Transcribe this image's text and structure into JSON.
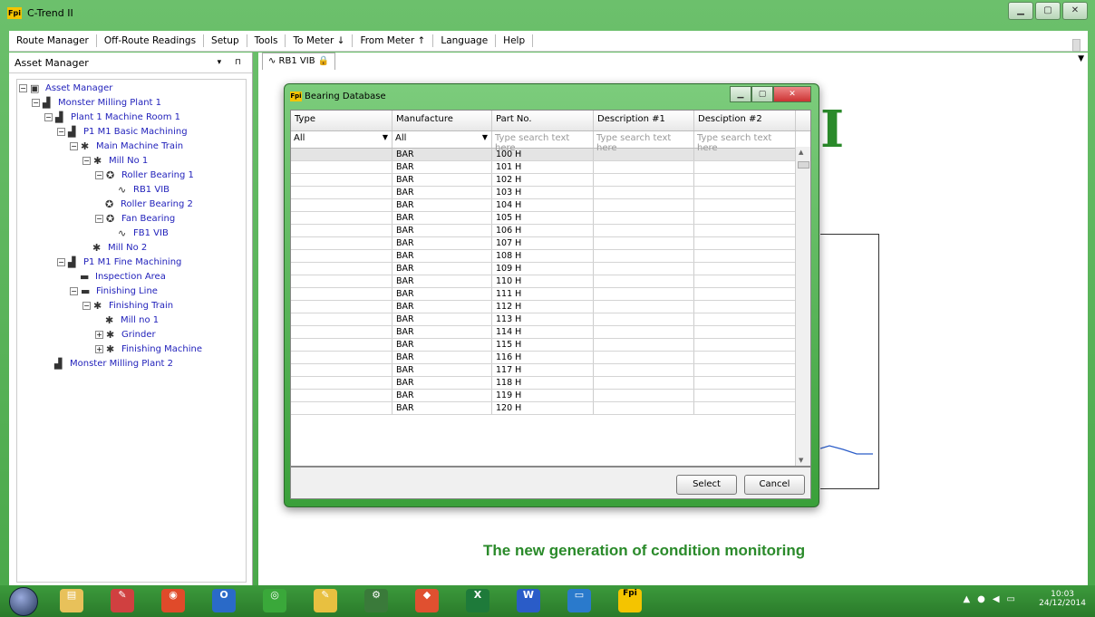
{
  "app": {
    "title": "C-Trend II",
    "logo_text": "Fpi"
  },
  "menu": [
    "Route Manager",
    "Off-Route Readings",
    "Setup",
    "Tools",
    "To Meter ↓",
    "From Meter ↑",
    "Language",
    "Help"
  ],
  "left_panel": {
    "title": "Asset Manager",
    "tools": "▾ ⊓"
  },
  "tree": [
    {
      "label": "Asset Manager",
      "icon": "folder-icon",
      "glyph": "▣",
      "depth": 0,
      "exp": "−"
    },
    {
      "label": "Monster Milling Plant 1",
      "icon": "plant-icon",
      "glyph": "▟",
      "depth": 1,
      "exp": "−"
    },
    {
      "label": "Plant 1 Machine Room 1",
      "icon": "factory-icon",
      "glyph": "▟",
      "depth": 2,
      "exp": "−"
    },
    {
      "label": "P1 M1 Basic Machining",
      "icon": "factory-icon",
      "glyph": "▟",
      "depth": 3,
      "exp": "−"
    },
    {
      "label": "Main Machine Train",
      "icon": "machine-train-icon",
      "glyph": "✱",
      "depth": 4,
      "exp": "−"
    },
    {
      "label": "Mill No 1",
      "icon": "mill-icon",
      "glyph": "✱",
      "depth": 5,
      "exp": "−"
    },
    {
      "label": "Roller Bearing 1",
      "icon": "bearing-icon",
      "glyph": "✪",
      "depth": 6,
      "exp": "−"
    },
    {
      "label": "RB1 VIB",
      "icon": "vibration-wave-icon",
      "glyph": "∿",
      "depth": 7,
      "exp": ""
    },
    {
      "label": "Roller Bearing 2",
      "icon": "bearing-icon",
      "glyph": "✪",
      "depth": 6,
      "exp": ""
    },
    {
      "label": "Fan Bearing",
      "icon": "bearing-icon",
      "glyph": "✪",
      "depth": 6,
      "exp": "−"
    },
    {
      "label": "FB1 VIB",
      "icon": "vibration-wave-icon",
      "glyph": "∿",
      "depth": 7,
      "exp": ""
    },
    {
      "label": "Mill No 2",
      "icon": "mill-icon",
      "glyph": "✱",
      "depth": 5,
      "exp": ""
    },
    {
      "label": "P1 M1 Fine Machining",
      "icon": "factory-icon",
      "glyph": "▟",
      "depth": 3,
      "exp": "−"
    },
    {
      "label": "Inspection Area",
      "icon": "area-icon",
      "glyph": "▬",
      "depth": 4,
      "exp": ""
    },
    {
      "label": "Finishing Line",
      "icon": "area-icon",
      "glyph": "▬",
      "depth": 4,
      "exp": "−"
    },
    {
      "label": "Finishing Train",
      "icon": "machine-train-icon",
      "glyph": "✱",
      "depth": 5,
      "exp": "−"
    },
    {
      "label": "Mill no 1",
      "icon": "mill-icon",
      "glyph": "✱",
      "depth": 6,
      "exp": ""
    },
    {
      "label": "Grinder",
      "icon": "mill-icon",
      "glyph": "✱",
      "depth": 6,
      "exp": "+"
    },
    {
      "label": "Finishing Machine",
      "icon": "mill-icon",
      "glyph": "✱",
      "depth": 6,
      "exp": "+"
    },
    {
      "label": "Monster Milling Plant 2",
      "icon": "plant-icon",
      "glyph": "▟",
      "depth": 2,
      "exp": ""
    }
  ],
  "tab": {
    "label": "∿ RB1 VIB 🔒"
  },
  "tagline": "The new generation of condition monitoring",
  "brand_letter": "I",
  "dialog": {
    "title": "Bearing Database",
    "columns": [
      "Type",
      "Manufacture",
      "Part No.",
      "Description #1",
      "Desciption #2"
    ],
    "filters": [
      "All",
      "All",
      "Type search text here",
      "Type search text here",
      "Type search text here"
    ],
    "rows": [
      [
        "",
        "BAR",
        "100 H",
        "",
        ""
      ],
      [
        "",
        "BAR",
        "101 H",
        "",
        ""
      ],
      [
        "",
        "BAR",
        "102 H",
        "",
        ""
      ],
      [
        "",
        "BAR",
        "103 H",
        "",
        ""
      ],
      [
        "",
        "BAR",
        "104 H",
        "",
        ""
      ],
      [
        "",
        "BAR",
        "105 H",
        "",
        ""
      ],
      [
        "",
        "BAR",
        "106 H",
        "",
        ""
      ],
      [
        "",
        "BAR",
        "107 H",
        "",
        ""
      ],
      [
        "",
        "BAR",
        "108 H",
        "",
        ""
      ],
      [
        "",
        "BAR",
        "109 H",
        "",
        ""
      ],
      [
        "",
        "BAR",
        "110 H",
        "",
        ""
      ],
      [
        "",
        "BAR",
        "111 H",
        "",
        ""
      ],
      [
        "",
        "BAR",
        "112 H",
        "",
        ""
      ],
      [
        "",
        "BAR",
        "113 H",
        "",
        ""
      ],
      [
        "",
        "BAR",
        "114 H",
        "",
        ""
      ],
      [
        "",
        "BAR",
        "115 H",
        "",
        ""
      ],
      [
        "",
        "BAR",
        "116 H",
        "",
        ""
      ],
      [
        "",
        "BAR",
        "117 H",
        "",
        ""
      ],
      [
        "",
        "BAR",
        "118 H",
        "",
        ""
      ],
      [
        "",
        "BAR",
        "119 H",
        "",
        ""
      ],
      [
        "",
        "BAR",
        "120 H",
        "",
        ""
      ]
    ],
    "select_label": "Select",
    "cancel_label": "Cancel"
  },
  "taskbar": {
    "apps": [
      {
        "name": "explorer-icon",
        "glyph": "▤",
        "color": "#e8c15a"
      },
      {
        "name": "paint-icon",
        "glyph": "✎",
        "color": "#d04040"
      },
      {
        "name": "chrome-icon",
        "glyph": "◉",
        "color": "#e04a2a"
      },
      {
        "name": "outlook-icon",
        "glyph": "O",
        "color": "#2a6ac8"
      },
      {
        "name": "media-icon",
        "glyph": "◎",
        "color": "#3aa83a"
      },
      {
        "name": "notes-icon",
        "glyph": "✎",
        "color": "#e8c040"
      },
      {
        "name": "tool-icon",
        "glyph": "⚙",
        "color": "#3a7a3a"
      },
      {
        "name": "git-icon",
        "glyph": "◆",
        "color": "#e05030"
      },
      {
        "name": "excel-icon",
        "glyph": "X",
        "color": "#1e7a3a"
      },
      {
        "name": "word-icon",
        "glyph": "W",
        "color": "#2a5cc8"
      },
      {
        "name": "remote-desktop-icon",
        "glyph": "▭",
        "color": "#2a7acc"
      },
      {
        "name": "ctrend-icon",
        "glyph": "Fpi",
        "color": "#f4c400"
      }
    ],
    "time": "10:03",
    "date": "24/12/2014"
  }
}
